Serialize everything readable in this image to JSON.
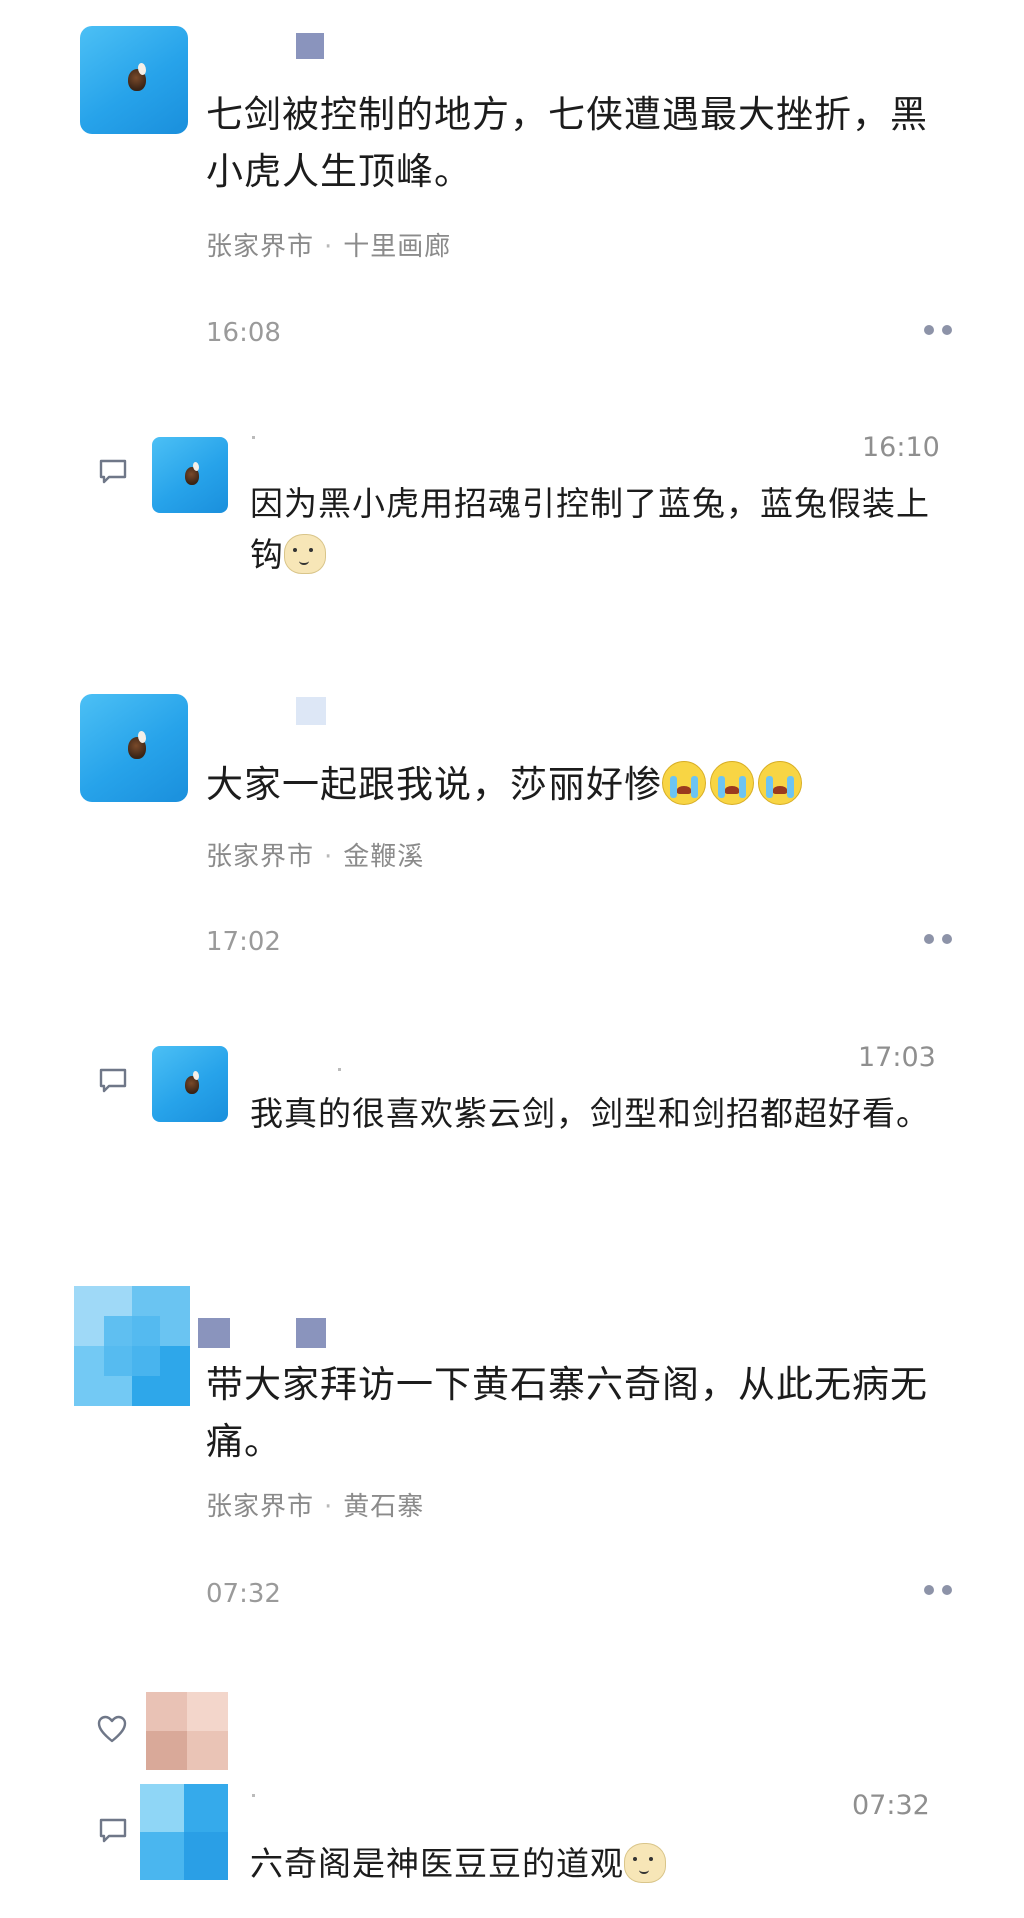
{
  "posts": [
    {
      "text": "七剑被控制的地方，七侠遭遇最大挫折，黑小虎人生顶峰。",
      "city": "张家界市",
      "place": "十里画廊",
      "time": "16:08",
      "reply": {
        "time": "16:10",
        "text": "因为黑小虎用招魂引控制了蓝兔，蓝兔假装上钩"
      }
    },
    {
      "text": "大家一起跟我说，莎丽好惨",
      "city": "张家界市",
      "place": "金鞭溪",
      "time": "17:02",
      "reply": {
        "time": "17:03",
        "text": "我真的很喜欢紫云剑，剑型和剑招都超好看。"
      }
    },
    {
      "text": "带大家拜访一下黄石寨六奇阁，从此无病无痛。",
      "city": "张家界市",
      "place": "黄石寨",
      "time": "07:32",
      "reply": {
        "time": "07:32",
        "text": "六奇阁是神医豆豆的道观"
      }
    }
  ],
  "icons": {
    "comment": "comment-bubble-icon",
    "like": "heart-icon",
    "more": "more-dots-icon",
    "emoji_cat": "doge-cat-emoji",
    "emoji_cry": "crying-face-emoji"
  },
  "colors": {
    "avatar": "#27a3ea",
    "location_text": "#8b8b8b",
    "dots": "#8d93a8"
  }
}
